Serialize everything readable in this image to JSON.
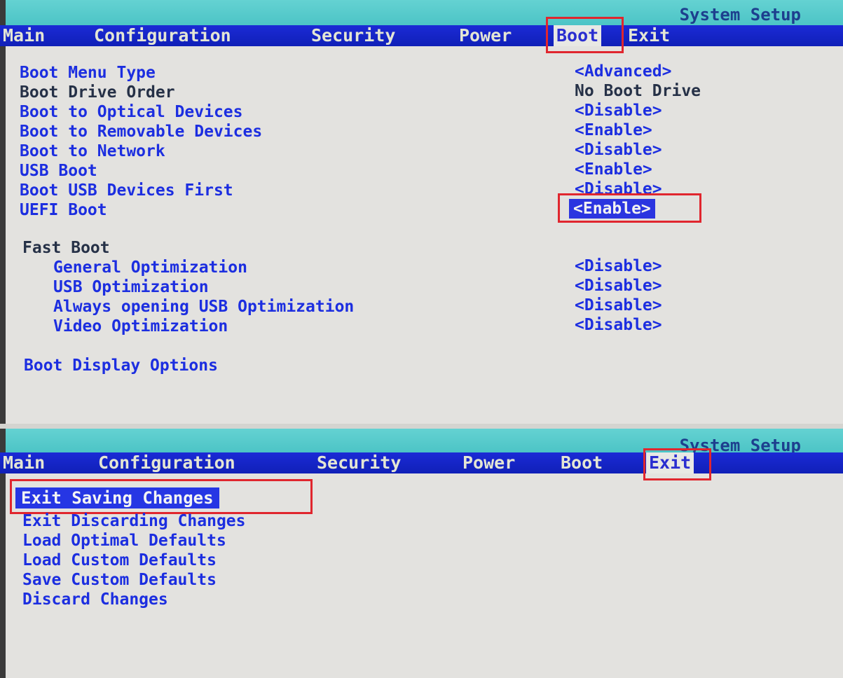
{
  "system_title": "System Setup",
  "tabs": [
    "Main",
    "Configuration",
    "Security",
    "Power",
    "Boot",
    "Exit"
  ],
  "boot_screen": {
    "active_tab": "Boot",
    "items": [
      {
        "label": "Boot Menu Type",
        "value": "<Advanced>"
      },
      {
        "label": "Boot Drive Order",
        "value": "No Boot Drive"
      },
      {
        "label": "Boot to Optical Devices",
        "value": "<Disable>"
      },
      {
        "label": "Boot to Removable Devices",
        "value": "<Enable>"
      },
      {
        "label": "Boot to Network",
        "value": "<Disable>"
      },
      {
        "label": "USB Boot",
        "value": "<Enable>"
      },
      {
        "label": "Boot USB Devices First",
        "value": "<Disable>"
      },
      {
        "label": "UEFI Boot",
        "value": "<Enable>"
      }
    ],
    "fast_boot": {
      "heading": "Fast Boot",
      "items": [
        {
          "label": "General Optimization",
          "value": "<Disable>"
        },
        {
          "label": "USB Optimization",
          "value": "<Disable>"
        },
        {
          "label": "Always opening USB Optimization",
          "value": "<Disable>"
        },
        {
          "label": "Video Optimization",
          "value": "<Disable>"
        }
      ]
    },
    "display_options": "Boot Display Options"
  },
  "exit_screen": {
    "active_tab": "Exit",
    "items": [
      "Exit Saving Changes",
      "Exit Discarding Changes",
      "Load Optimal Defaults",
      "Load Custom Defaults",
      "Save Custom Defaults",
      "Discard Changes"
    ]
  },
  "colors": {
    "menubar": "#1b2ad6",
    "title_band": "#4cc4c6",
    "body_bg": "#e3e2df",
    "item_text": "#1c2ee0",
    "highlight_border": "#e0262e"
  }
}
